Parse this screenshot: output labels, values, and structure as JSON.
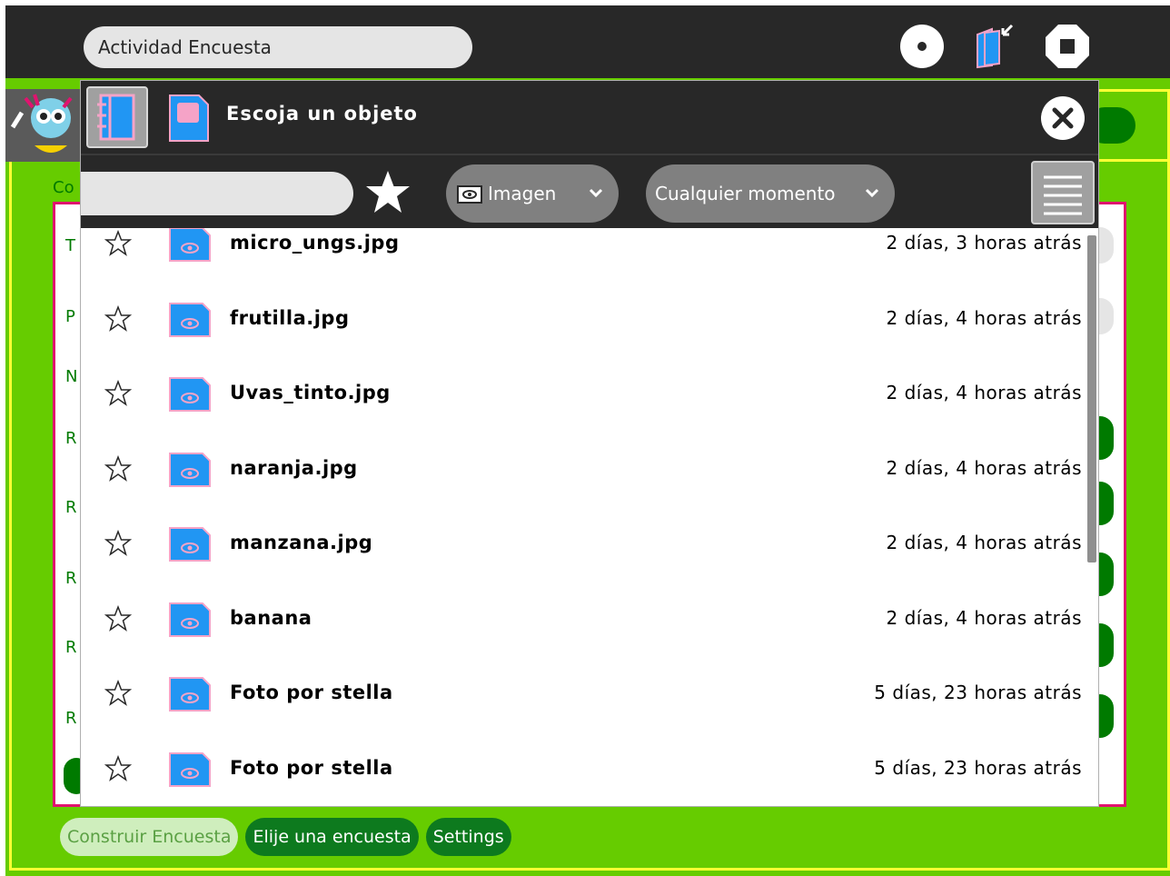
{
  "toolbar": {
    "title_value": "Actividad Encuesta",
    "icons": [
      "record-icon",
      "journal-return-icon",
      "stop-icon"
    ]
  },
  "chooser": {
    "title": "Escoja un objeto",
    "search_value": "",
    "type_filter": "Imagen",
    "time_filter": "Cualquier momento",
    "entries": [
      {
        "name": "micro_ungs.jpg",
        "time": "2 días, 3 horas atrás"
      },
      {
        "name": "frutilla.jpg",
        "time": "2 días, 4 horas atrás"
      },
      {
        "name": "Uvas_tinto.jpg",
        "time": "2 días, 4 horas atrás"
      },
      {
        "name": "naranja.jpg",
        "time": "2 días, 4 horas atrás"
      },
      {
        "name": "manzana.jpg",
        "time": "2 días, 4 horas atrás"
      },
      {
        "name": "banana",
        "time": "2 días, 4 horas atrás"
      },
      {
        "name": "Foto por stella",
        "time": "5 días, 23 horas atrás"
      },
      {
        "name": "Foto por stella",
        "time": "5 días, 23 horas atrás"
      }
    ]
  },
  "background": {
    "partial_labels": [
      "Co",
      "T",
      "P",
      "N",
      "R",
      "R",
      "R",
      "R",
      "R"
    ],
    "tabs": [
      "Construir Encuesta",
      "Elije una encuesta",
      "Settings"
    ]
  },
  "colors": {
    "toolbar_bg": "#282828",
    "activity_green": "#66cc00",
    "dark_green": "#007a00",
    "frame_magenta": "#e0136f",
    "thumb_blue": "#2196f3",
    "thumb_pink": "#f5a3c7"
  }
}
